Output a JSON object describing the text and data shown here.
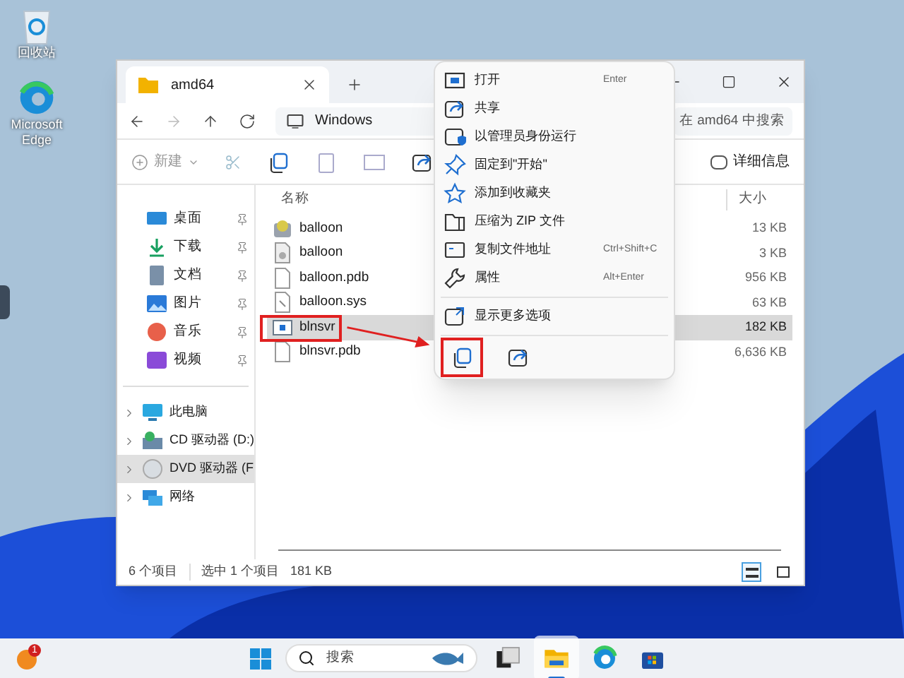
{
  "desktop_icons": [
    {
      "kind": "recycle",
      "label": "回收站"
    },
    {
      "kind": "edge",
      "label": "Microsoft Edge"
    }
  ],
  "window": {
    "tab": "amd64",
    "address": "Windows",
    "search": {
      "placeholder": "在 amd64 中搜索"
    },
    "new_button": "新建",
    "details_button": "详细信息"
  },
  "sidebar": {
    "quick": [
      {
        "kind": "desktop",
        "label": "桌面"
      },
      {
        "kind": "download",
        "label": "下载"
      },
      {
        "kind": "docs",
        "label": "文档"
      },
      {
        "kind": "pictures",
        "label": "图片"
      },
      {
        "kind": "music",
        "label": "音乐"
      },
      {
        "kind": "video",
        "label": "视频"
      }
    ],
    "tree": [
      {
        "kind": "pc",
        "label": "此电脑",
        "selected": false
      },
      {
        "kind": "cd",
        "label": "CD 驱动器 (D:)",
        "selected": false
      },
      {
        "kind": "dvd",
        "label": "DVD 驱动器 (F",
        "selected": true
      },
      {
        "kind": "network",
        "label": "网络",
        "selected": false
      }
    ]
  },
  "table": {
    "columns": [
      "名称",
      "大小"
    ],
    "rows": [
      {
        "kind": "setup",
        "name": "balloon",
        "size": "13 KB",
        "selected": false
      },
      {
        "kind": "generic",
        "name": "balloon",
        "size": "3 KB",
        "selected": false
      },
      {
        "kind": "doc",
        "name": "balloon.pdb",
        "size": "956 KB",
        "selected": false
      },
      {
        "kind": "sys",
        "name": "balloon.sys",
        "size": "63 KB",
        "selected": false
      },
      {
        "kind": "exe",
        "name": "blnsvr",
        "size": "182 KB",
        "selected": true
      },
      {
        "kind": "doc",
        "name": "blnsvr.pdb",
        "size": "6,636 KB",
        "selected": false
      }
    ]
  },
  "status_bar": {
    "count": "6 个项目",
    "selection": "选中 1 个项目",
    "size": "181 KB",
    "views": [
      {
        "kind": "details",
        "selected": true
      },
      {
        "kind": "tiles",
        "selected": false
      }
    ]
  },
  "context_menu": {
    "items": [
      {
        "kind": "open",
        "label": "打开",
        "shortcut": "Enter"
      },
      {
        "kind": "share",
        "label": "共享"
      },
      {
        "kind": "admin",
        "label": "以管理员身份运行"
      },
      {
        "kind": "pin",
        "label": "固定到\"开始\""
      },
      {
        "kind": "star",
        "label": "添加到收藏夹"
      },
      {
        "kind": "zip",
        "label": "压缩为 ZIP 文件"
      },
      {
        "kind": "path",
        "label": "复制文件地址",
        "shortcut": "Ctrl+Shift+C"
      },
      {
        "kind": "props",
        "label": "属性",
        "shortcut": "Alt+Enter"
      },
      {
        "kind": "more",
        "label": "显示更多选项",
        "separator": true
      }
    ],
    "bottom_icons": [
      {
        "kind": "copy",
        "highlighted": true
      },
      {
        "kind": "share",
        "highlighted": false
      }
    ]
  },
  "taskbar": {
    "notification_badge": "1",
    "search": {
      "placeholder": "搜索"
    },
    "apps": [
      {
        "kind": "taskview",
        "active": false
      },
      {
        "kind": "explorer",
        "active": true
      },
      {
        "kind": "edge",
        "active": false
      },
      {
        "kind": "store",
        "active": false
      }
    ]
  }
}
